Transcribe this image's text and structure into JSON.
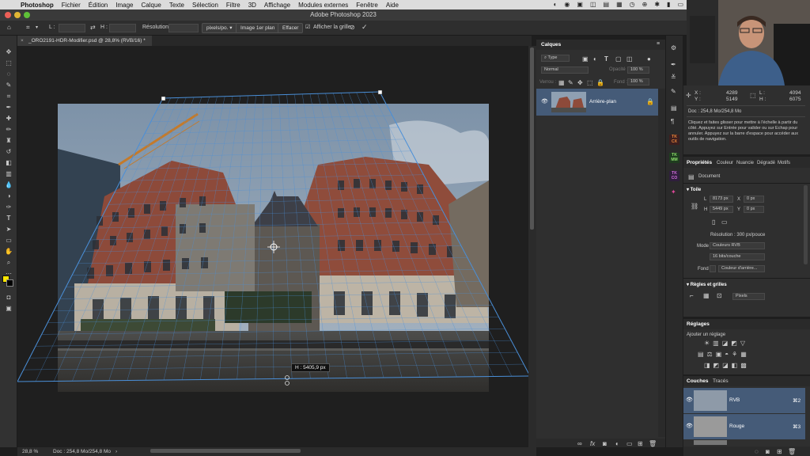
{
  "menubar": {
    "app": "Photoshop",
    "items": [
      "Fichier",
      "Édition",
      "Image",
      "Calque",
      "Texte",
      "Sélection",
      "Filtre",
      "3D",
      "Affichage",
      "Fenêtre",
      "Aide"
    ],
    "extra": "Modules externes"
  },
  "window": {
    "title": "Adobe Photoshop 2023"
  },
  "options": {
    "l_label": "L :",
    "h_label": "H :",
    "resolution_label": "Résolution :",
    "unit": "pixels/po.",
    "front_image_button": "Image 1er plan",
    "clear_button": "Effacer",
    "show_grid_label": "Afficher la grille"
  },
  "document": {
    "tab_title": "_ORO2191-HDR-Modifier.psd @ 28,8% (RVB/16) *",
    "dimension_tooltip": "H : 5405,9 px"
  },
  "status": {
    "zoom": "28,8 %",
    "doc": "Doc : 254,8 Mo/254,8 Mo"
  },
  "layers_panel": {
    "title": "Calques",
    "filter_placeholder": "Type",
    "blend_mode": "Normal",
    "opacity_label": "Opacité :",
    "opacity_value": "100 %",
    "lock_label": "Verrou :",
    "fill_label": "Fond :",
    "fill_value": "100 %",
    "layer_name": "Arrière-plan"
  },
  "info_panel": {
    "x_label": "X :",
    "y_label": "Y :",
    "x_value": "4289",
    "y_value": "5149",
    "l_label": "L :",
    "h_label": "H :",
    "l_value": "4094",
    "h_value": "6075",
    "doc": "Doc : 254,8 Mo/254,8 Mo",
    "help": "Cliquez et faites glisser pour mettre à l'échelle à partir du côté. Appuyez sur Entrée pour valider ou sur Echap pour annuler. Appuyez sur la barre d'espace pour accéder aux outils de navigation."
  },
  "properties_panel": {
    "tabs": [
      "Propriétés",
      "Couleur",
      "Nuancie",
      "Dégradé",
      "Motifs"
    ],
    "doc_label": "Document",
    "canvas_section": "Toile",
    "w_label": "L",
    "w_value": "8173 px",
    "h_label": "H",
    "h_value": "5449 px",
    "x_label": "X",
    "x_value": "0 px",
    "y_label": "Y",
    "y_value": "0 px",
    "resolution": "Résolution : 300 px/pouce",
    "mode_label": "Mode",
    "mode_value": "Couleurs RVB",
    "depth_value": "16 bits/couche",
    "fill_label": "Fond",
    "fill_value": "Couleur d'arrière...",
    "rulers_section": "Règles et grilles",
    "units_value": "Pixels"
  },
  "adjustments_panel": {
    "title": "Réglages",
    "add_label": "Ajouter un réglage"
  },
  "channels_panel": {
    "tabs": [
      "Couches",
      "Tracés"
    ],
    "channels": [
      {
        "name": "RVB",
        "shortcut": "⌘2"
      },
      {
        "name": "Rouge",
        "shortcut": "⌘3"
      }
    ]
  },
  "iconstrip": {
    "tk_labels": [
      "TK CX",
      "TK MM",
      "TK CO"
    ]
  },
  "colors": {
    "foreground": "#ffe600",
    "background": "#000000",
    "transform_line": "#4a8fd8",
    "selection_row": "#455b78"
  }
}
